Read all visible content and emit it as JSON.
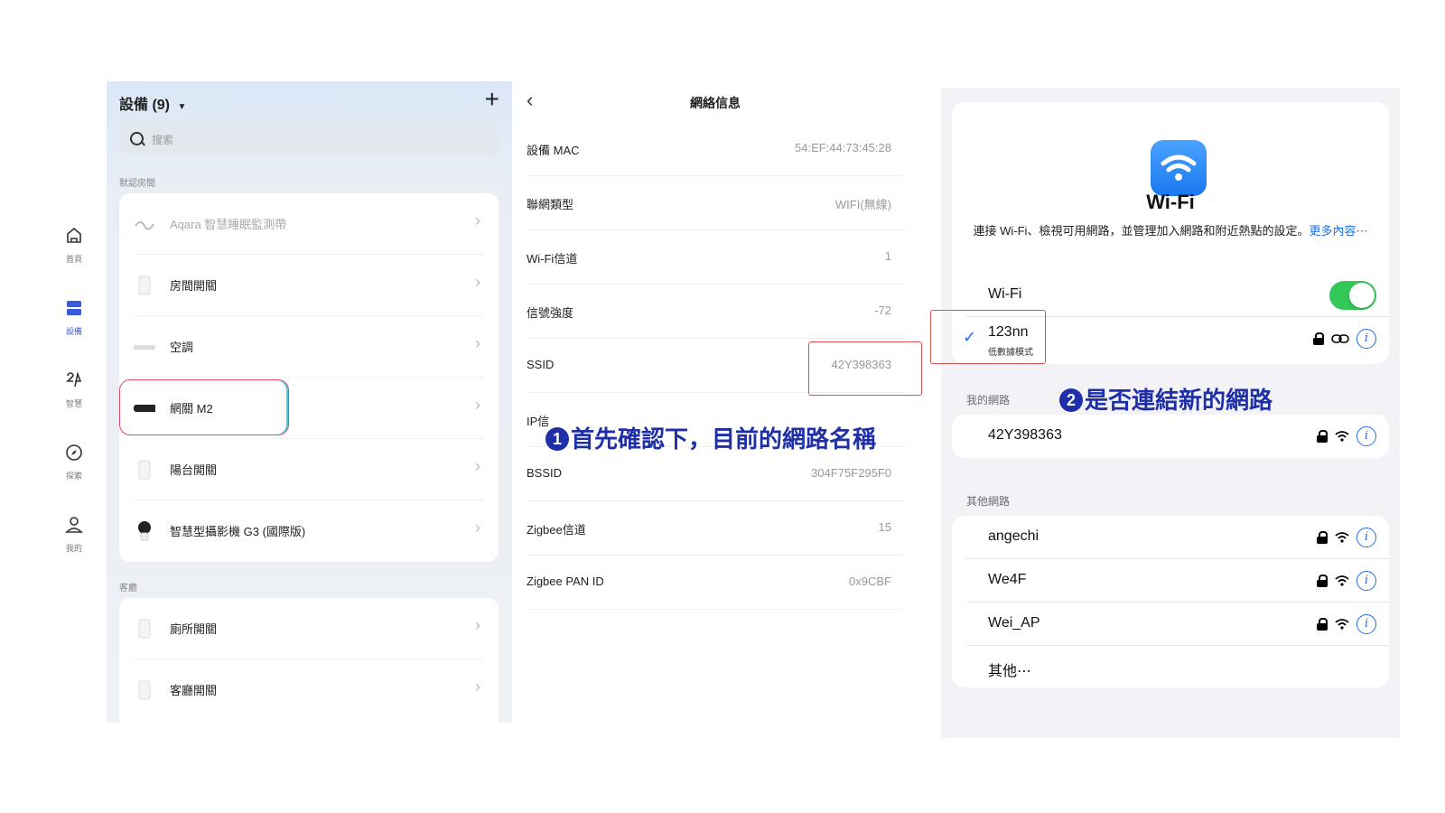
{
  "nav": {
    "items": [
      {
        "label": "首頁",
        "icon": "home-icon"
      },
      {
        "label": "設備",
        "icon": "devices-icon",
        "active": true
      },
      {
        "label": "智慧",
        "icon": "automation-icon"
      },
      {
        "label": "探索",
        "icon": "compass-icon"
      },
      {
        "label": "我的",
        "icon": "user-icon"
      }
    ]
  },
  "devices": {
    "title": "設備 (9)",
    "add": "+",
    "search_placeholder": "搜索",
    "group1": "默認房間",
    "group1_items": [
      {
        "name": "Aqara 智慧睡眠監測帶",
        "faded": true
      },
      {
        "name": "房間開關"
      },
      {
        "name": "空調"
      },
      {
        "name": "網關 M2"
      },
      {
        "name": "陽台開關"
      },
      {
        "name": "智慧型攝影機 G3 (國際版)"
      }
    ],
    "group2": "客廳",
    "group2_items": [
      {
        "name": "廁所開關"
      },
      {
        "name": "客廳開關"
      }
    ]
  },
  "network_info": {
    "back": "‹",
    "title": "網絡信息",
    "rows": [
      {
        "key": "設備 MAC",
        "value": "54:EF:44:73:45:28"
      },
      {
        "key": "聯網類型",
        "value": "WIFI(無線)"
      },
      {
        "key": "Wi-Fi信道",
        "value": "1"
      },
      {
        "key": "信號強度",
        "value": "-72"
      },
      {
        "key": "SSID",
        "value": "42Y398363"
      },
      {
        "key": "IP信",
        "value": ""
      },
      {
        "key": "BSSID",
        "value": "304F75F295F0"
      },
      {
        "key": "Zigbee信道",
        "value": "15"
      },
      {
        "key": "Zigbee PAN ID",
        "value": "0x9CBF"
      }
    ]
  },
  "annotations": {
    "step1_num": "1",
    "step1": "首先確認下，目前的網路名稱",
    "step2_num": "2",
    "step2": "是否連結新的網路"
  },
  "wifi": {
    "heading": "Wi-Fi",
    "description": "連接 Wi-Fi、檢視可用網路，並管理加入網路和附近熱點的設定。",
    "more": "更多內容⋯",
    "toggle_label": "Wi-Fi",
    "toggle_on": true,
    "connected": {
      "name": "123nn",
      "sub": "低數據模式"
    },
    "my_networks_label": "我的網路",
    "my_networks": [
      "42Y398363"
    ],
    "other_networks_label": "其他網路",
    "other_networks": [
      "angechi",
      "We4F",
      "Wei_AP"
    ],
    "other_label": "其他⋯",
    "info_glyph": "i",
    "accent": "#1a6ff0",
    "toggle_color": "#34c759"
  }
}
